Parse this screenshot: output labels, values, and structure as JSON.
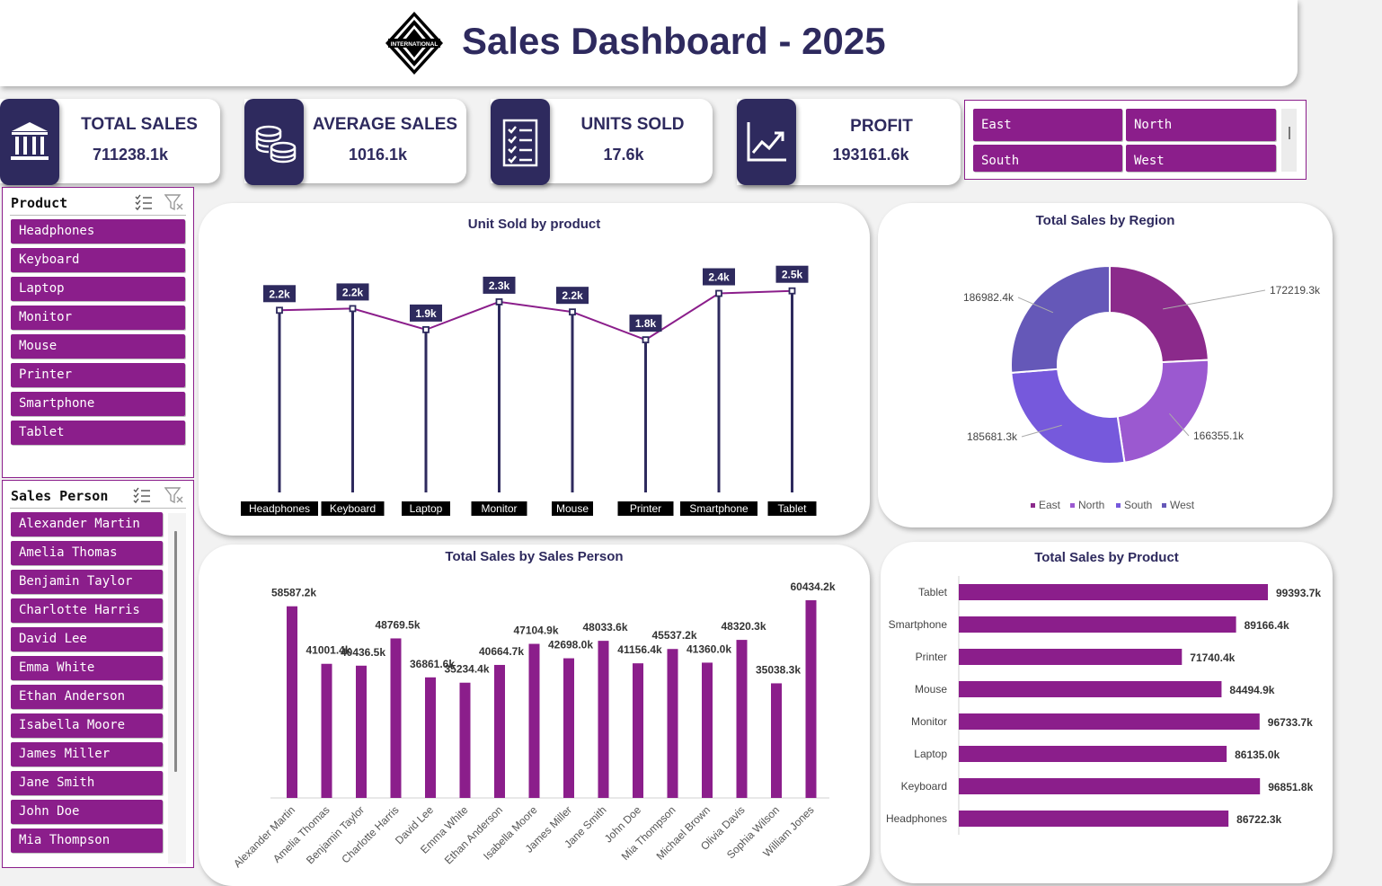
{
  "header": {
    "title": "Sales Dashboard - 2025",
    "logo_text": "INTERNATIONAL"
  },
  "kpis": [
    {
      "label": "TOTAL SALES",
      "value": "711238.1k",
      "icon": "bank-icon"
    },
    {
      "label": "AVERAGE SALES",
      "value": "1016.1k",
      "icon": "coins-icon"
    },
    {
      "label": "UNITS SOLD",
      "value": "17.6k",
      "icon": "checklist-icon"
    },
    {
      "label": "PROFIT",
      "value": "193161.6k",
      "icon": "trend-up-icon"
    }
  ],
  "region_slicer": {
    "items": [
      "East",
      "North",
      "South",
      "West"
    ]
  },
  "product_slicer": {
    "title": "Product",
    "items": [
      "Headphones",
      "Keyboard",
      "Laptop",
      "Monitor",
      "Mouse",
      "Printer",
      "Smartphone",
      "Tablet"
    ]
  },
  "salesperson_slicer": {
    "title": "Sales Person",
    "items": [
      "Alexander Martin",
      "Amelia Thomas",
      "Benjamin Taylor",
      "Charlotte Harris",
      "David Lee",
      "Emma White",
      "Ethan Anderson",
      "Isabella Moore",
      "James Miller",
      "Jane Smith",
      "John Doe",
      "Mia Thompson"
    ]
  },
  "colors": {
    "navy": "#2e2a5e",
    "purple": "#8b1e8b",
    "east": "#8b2a8b",
    "north": "#9b59d0",
    "south": "#7659dc",
    "west": "#6558b8"
  },
  "chart_data": [
    {
      "id": "units",
      "type": "line",
      "title": "Unit Sold by product",
      "categories": [
        "Headphones",
        "Keyboard",
        "Laptop",
        "Monitor",
        "Mouse",
        "Printer",
        "Smartphone",
        "Tablet"
      ],
      "values": [
        2.16,
        2.18,
        1.93,
        2.26,
        2.14,
        1.81,
        2.36,
        2.39
      ],
      "labels": [
        "2.2k",
        "2.2k",
        "1.9k",
        "2.3k",
        "2.2k",
        "1.8k",
        "2.4k",
        "2.5k"
      ],
      "ylim": [
        0,
        2.6
      ],
      "grid": false
    },
    {
      "id": "region",
      "type": "pie",
      "title": "Total Sales by Region",
      "categories": [
        "East",
        "North",
        "South",
        "West"
      ],
      "values": [
        172219.3,
        166355.1,
        185681.3,
        186982.4
      ],
      "labels": [
        "172219.3k",
        "166355.1k",
        "185681.3k",
        "186982.4k"
      ],
      "legend": "bottom"
    },
    {
      "id": "salesperson",
      "type": "bar",
      "title": "Total Sales by Sales Person",
      "categories": [
        "Alexander Martin",
        "Amelia Thomas",
        "Benjamin Taylor",
        "Charlotte Harris",
        "David Lee",
        "Emma White",
        "Ethan Anderson",
        "Isabella Moore",
        "James Miller",
        "Jane Smith",
        "John Doe",
        "Mia Thompson",
        "Michael Brown",
        "Olivia Davis",
        "Sophia Wilson",
        "William Jones"
      ],
      "values": [
        58587.2,
        41001.4,
        40436.5,
        48769.5,
        36861.6,
        35234.4,
        40664.7,
        47104.9,
        42698.0,
        48033.6,
        41156.4,
        45537.2,
        41360.0,
        48320.3,
        35038.3,
        60434.2
      ],
      "labels": [
        "58587.2k",
        "41001.4k",
        "40436.5k",
        "48769.5k",
        "36861.6k",
        "35234.4k",
        "40664.7k",
        "47104.9k",
        "42698.0k",
        "48033.6k",
        "41156.4k",
        "45537.2k",
        "41360.0k",
        "48320.3k",
        "35038.3k",
        "60434.2k"
      ],
      "ylim": [
        0,
        60434.2
      ],
      "grid": false
    },
    {
      "id": "product",
      "type": "bar",
      "orientation": "horizontal",
      "title": "Total Sales by Product",
      "categories": [
        "Tablet",
        "Smartphone",
        "Printer",
        "Mouse",
        "Monitor",
        "Laptop",
        "Keyboard",
        "Headphones"
      ],
      "values": [
        99393.7,
        89166.4,
        71740.4,
        84494.9,
        96733.7,
        86135.0,
        96851.8,
        86722.3
      ],
      "labels": [
        "99393.7k",
        "89166.4k",
        "71740.4k",
        "84494.9k",
        "96733.7k",
        "86135.0k",
        "96851.8k",
        "86722.3k"
      ],
      "xlim": [
        0,
        99393.7
      ],
      "grid": false
    }
  ]
}
